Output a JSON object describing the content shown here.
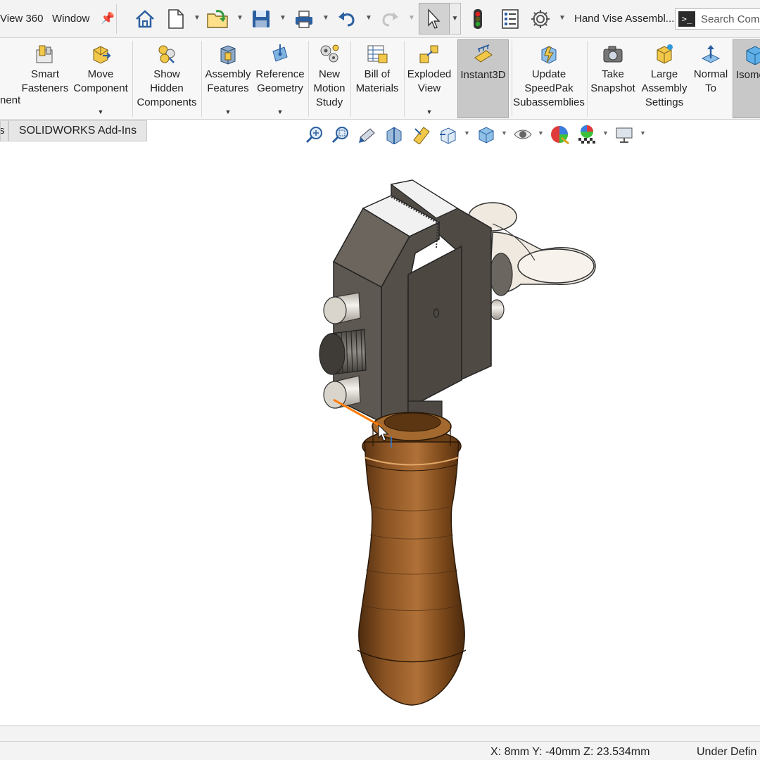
{
  "menu": {
    "items": [
      "View 360",
      "Window"
    ],
    "pin_icon": "pin-icon"
  },
  "quick_access": {
    "icons": [
      "home-icon",
      "new-document-icon",
      "open-icon",
      "save-icon",
      "print-icon",
      "undo-icon",
      "redo-icon",
      "select-cursor-icon",
      "rebuild-traffic-light-icon",
      "file-properties-icon",
      "options-gear-icon"
    ],
    "document_title": "Hand Vise Assembl...",
    "search_placeholder": "Search Comm"
  },
  "ribbon": {
    "buttons": [
      {
        "label": "nent",
        "icon": "insert-component-icon"
      },
      {
        "label": "Smart\nFasteners",
        "icon": "smart-fasteners-icon"
      },
      {
        "label": "Move\nComponent",
        "icon": "move-component-icon"
      },
      {
        "label": "Show\nHidden\nComponents",
        "icon": "show-hidden-components-icon"
      },
      {
        "label": "Assembly\nFeatures",
        "icon": "assembly-features-icon"
      },
      {
        "label": "Reference\nGeometry",
        "icon": "reference-geometry-icon"
      },
      {
        "label": "New\nMotion\nStudy",
        "icon": "motion-study-icon"
      },
      {
        "label": "Bill of\nMaterials",
        "icon": "bill-of-materials-icon"
      },
      {
        "label": "Exploded\nView",
        "icon": "exploded-view-icon"
      },
      {
        "label": "Instant3D",
        "icon": "instant3d-icon",
        "active": true
      },
      {
        "label": "Update\nSpeedPak\nSubassemblies",
        "icon": "speedpak-icon"
      },
      {
        "label": "Take\nSnapshot",
        "icon": "camera-icon"
      },
      {
        "label": "Large\nAssembly\nSettings",
        "icon": "large-assembly-icon"
      },
      {
        "label": "Normal\nTo",
        "icon": "normal-to-icon"
      },
      {
        "label": "Isome",
        "icon": "isometric-icon",
        "active": true
      }
    ]
  },
  "tabs": {
    "stub_label": "s",
    "active_label": "SOLIDWORKS Add-Ins"
  },
  "view_toolbar": {
    "icons": [
      "zoom-to-fit-icon",
      "zoom-to-area-icon",
      "previous-view-icon",
      "section-view-icon",
      "dynamic-annotation-icon",
      "view-orientation-icon",
      "display-style-icon",
      "hide-show-items-icon",
      "edit-appearance-icon",
      "apply-scene-icon",
      "view-settings-icon"
    ]
  },
  "status": {
    "coordinates": "X: 8mm Y: -40mm Z: 23.534mm",
    "definition_state": "Under Defin"
  },
  "model": {
    "name": "hand-vise-model",
    "colors": {
      "steel": "#5f5a54",
      "steel_top": "#eeeeee",
      "wood": "#8a5323",
      "wood_dark": "#5a3414",
      "pin": "#d9d4cc",
      "highlight": "#ff7a00"
    }
  }
}
